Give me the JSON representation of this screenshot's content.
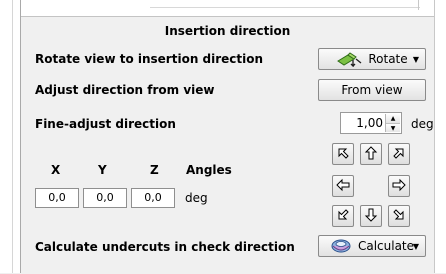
{
  "section": {
    "title": "Insertion direction"
  },
  "rotate": {
    "label": "Rotate view to insertion direction",
    "button_label": "Rotate",
    "button_icon": "rotate-view-icon"
  },
  "adjust": {
    "label": "Adjust direction from view",
    "button_label": "From view"
  },
  "fine_adjust": {
    "label": "Fine-adjust direction",
    "value": "1,00",
    "unit": "deg"
  },
  "angles": {
    "headers": {
      "x": "X",
      "y": "Y",
      "z": "Z",
      "angles": "Angles"
    },
    "values": {
      "x": "0,0",
      "y": "0,0",
      "z": "0,0"
    },
    "unit": "deg"
  },
  "arrow_pad": {
    "up_left_icon": "arrow-up-left-icon",
    "up_icon": "arrow-up-icon",
    "up_right_icon": "arrow-up-right-icon",
    "left_icon": "arrow-left-icon",
    "right_icon": "arrow-right-icon",
    "down_left_icon": "arrow-down-left-icon",
    "down_icon": "arrow-down-icon",
    "down_right_icon": "arrow-down-right-icon"
  },
  "undercuts": {
    "label": "Calculate undercuts in check direction",
    "button_label": "Calculate",
    "button_icon": "calculate-undercuts-icon"
  }
}
